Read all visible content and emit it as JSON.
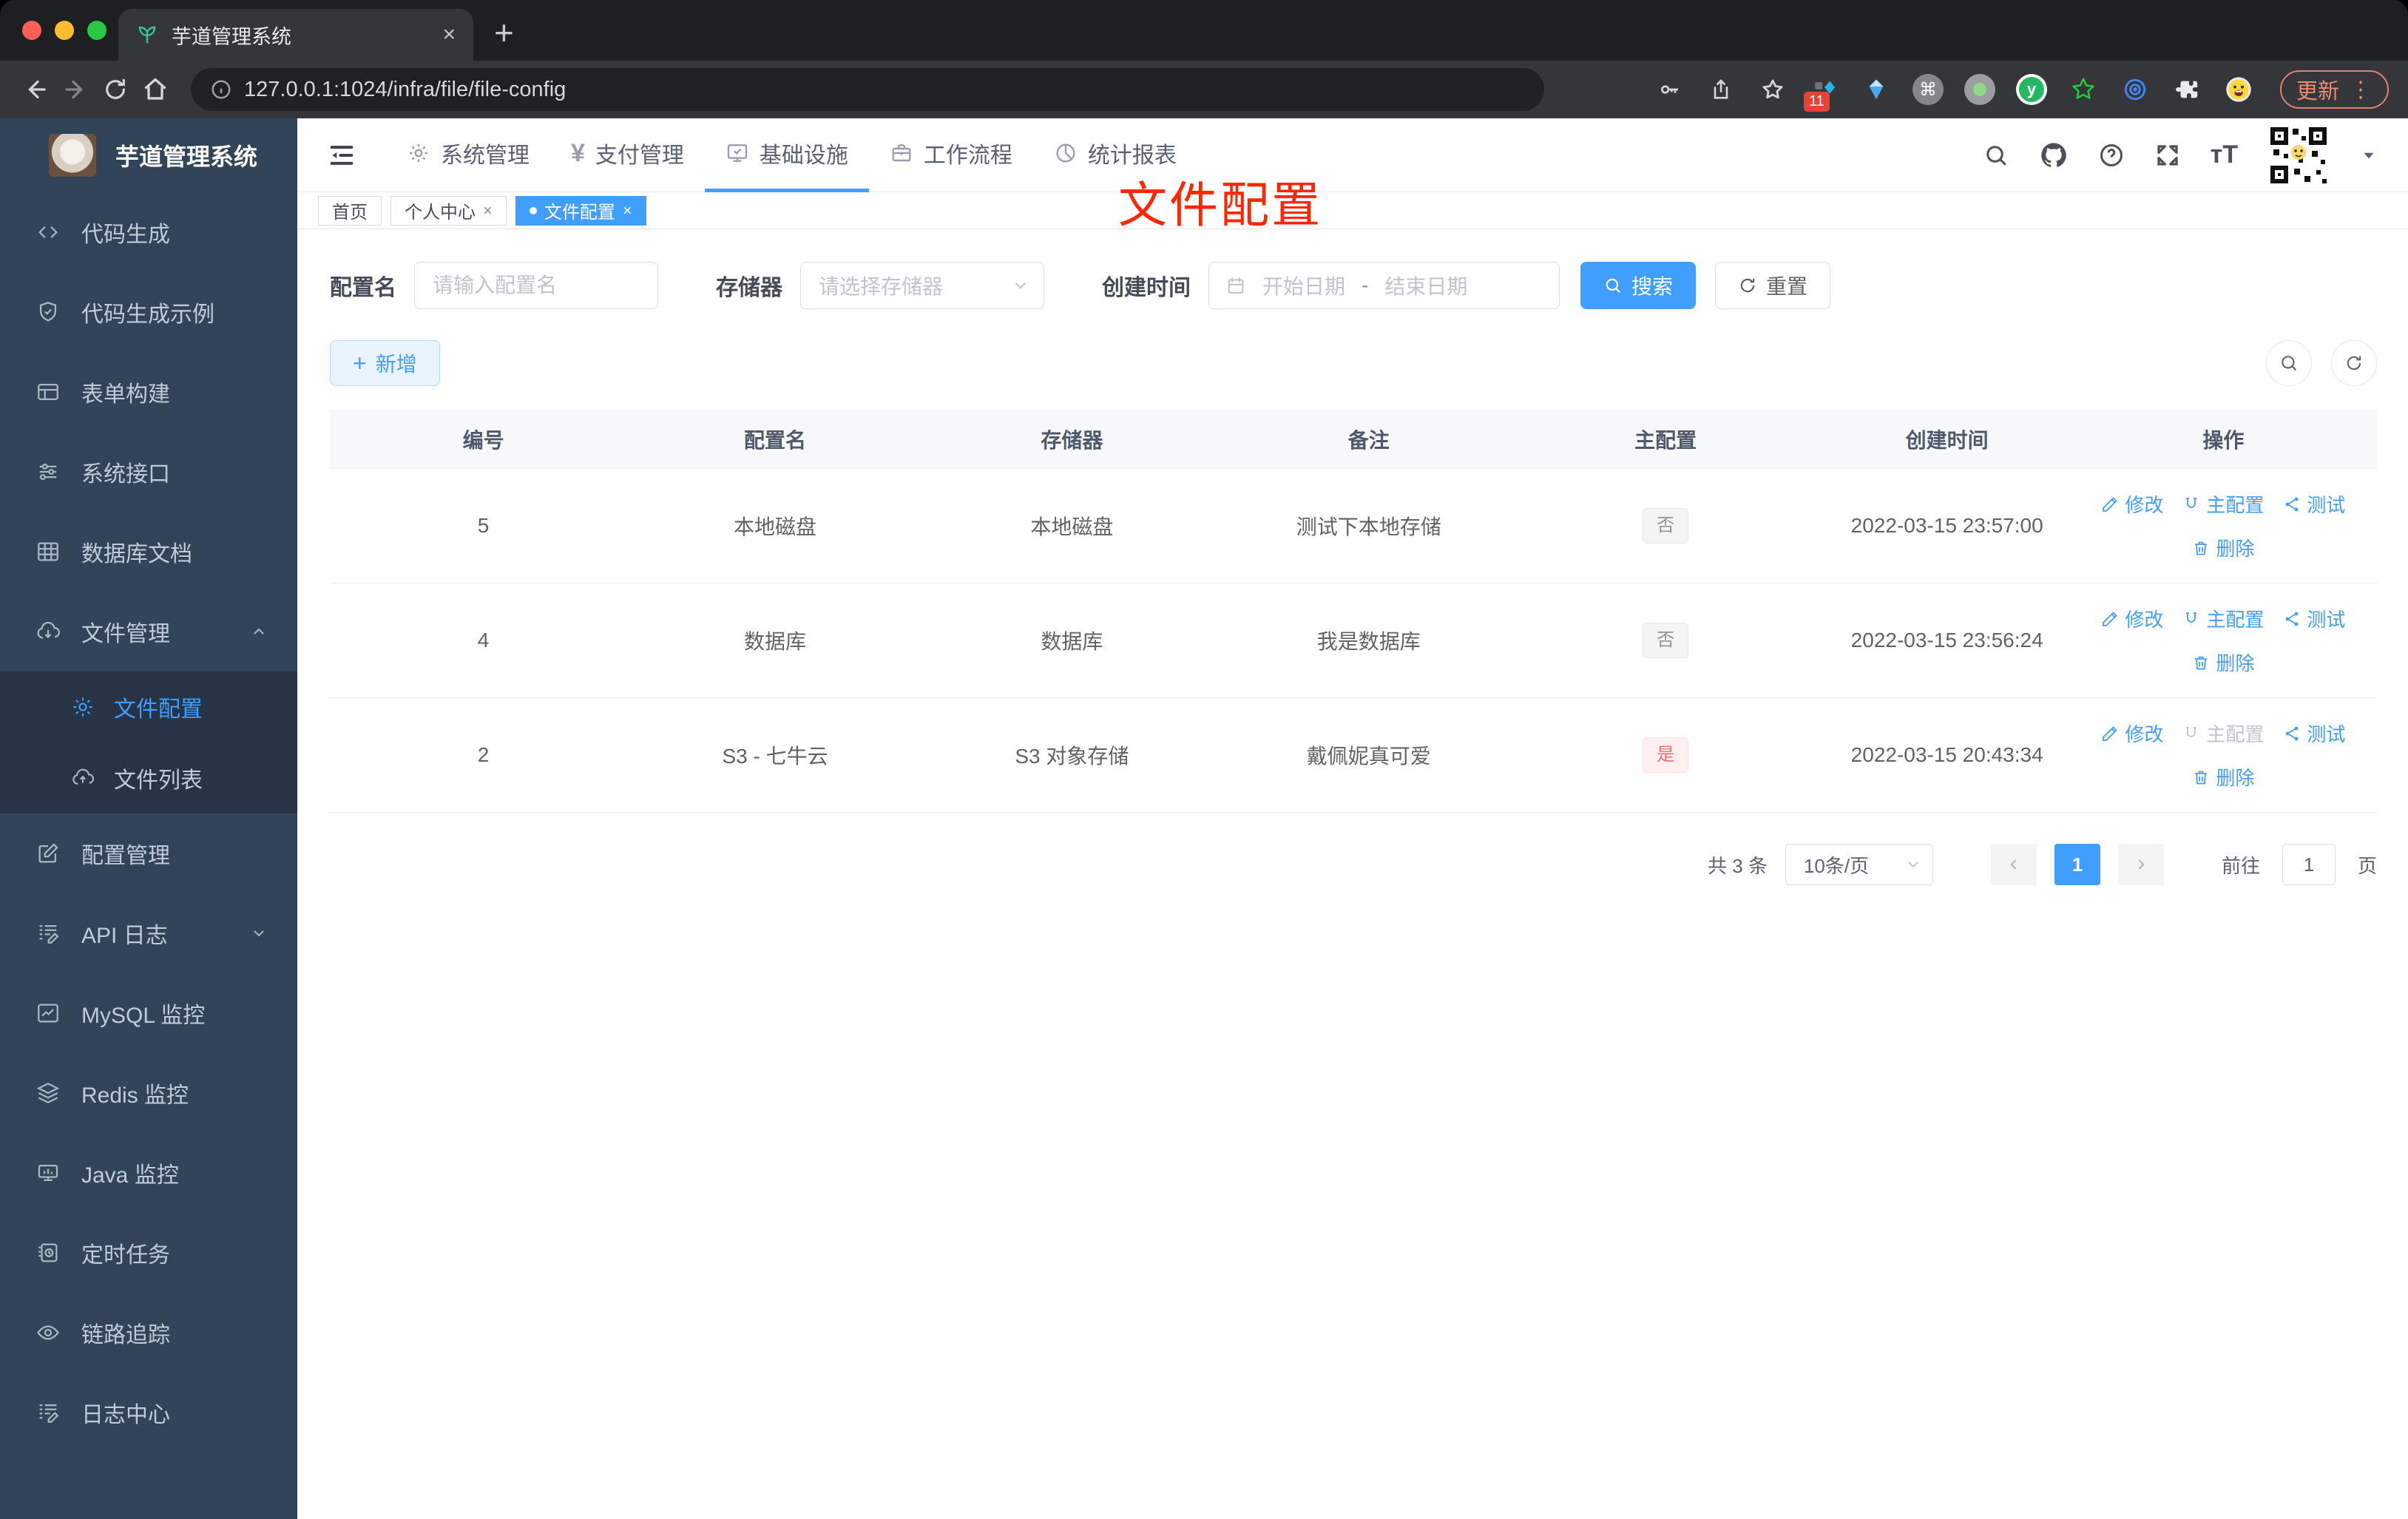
{
  "browser": {
    "tab_title": "芋道管理系统",
    "url": "127.0.0.1:1024/infra/file/file-config",
    "extension_badge": "11",
    "update_label": "更新",
    "toolbar_icons": [
      "back-icon",
      "forward-icon",
      "reload-icon",
      "home-icon",
      "info-icon",
      "key-icon",
      "share-icon",
      "star-icon",
      "extensions",
      "puzzle-icon",
      "emoji-icon",
      "update-chip",
      "menu-dots-icon"
    ]
  },
  "sidebar": {
    "app_title": "芋道管理系统",
    "items": [
      {
        "label": "代码生成",
        "icon": "code-icon"
      },
      {
        "label": "代码生成示例",
        "icon": "shield-check-icon"
      },
      {
        "label": "表单构建",
        "icon": "form-icon"
      },
      {
        "label": "系统接口",
        "icon": "sliders-icon"
      },
      {
        "label": "数据库文档",
        "icon": "table-grid-icon"
      },
      {
        "label": "文件管理",
        "icon": "cloud-download-icon",
        "expanded": true,
        "children": [
          {
            "label": "文件配置",
            "icon": "gear-icon",
            "active": true
          },
          {
            "label": "文件列表",
            "icon": "cloud-upload-icon"
          }
        ]
      },
      {
        "label": "配置管理",
        "icon": "edit-square-icon"
      },
      {
        "label": "API 日志",
        "icon": "log-edit-icon",
        "collapsed": true
      },
      {
        "label": "MySQL 监控",
        "icon": "chart-monitor-icon"
      },
      {
        "label": "Redis 监控",
        "icon": "layers-icon"
      },
      {
        "label": "Java 监控",
        "icon": "java-monitor-icon"
      },
      {
        "label": "定时任务",
        "icon": "schedule-icon"
      },
      {
        "label": "链路追踪",
        "icon": "eye-icon"
      },
      {
        "label": "日志中心",
        "icon": "logfile-icon"
      }
    ]
  },
  "topnav": {
    "items": [
      {
        "label": "系统管理",
        "icon": "gear-icon"
      },
      {
        "label": "支付管理",
        "icon": "yen-icon"
      },
      {
        "label": "基础设施",
        "icon": "monitor-check-icon",
        "active": true
      },
      {
        "label": "工作流程",
        "icon": "briefcase-icon"
      },
      {
        "label": "统计报表",
        "icon": "pie-chart-icon"
      }
    ],
    "tools": [
      "search-icon",
      "github-icon",
      "help-icon",
      "fullscreen-icon",
      "font-size-icon",
      "qr-avatar",
      "caret-down-icon"
    ]
  },
  "tagsview": {
    "tabs": [
      {
        "label": "首页"
      },
      {
        "label": "个人中心",
        "closable": true
      },
      {
        "label": "文件配置",
        "closable": true,
        "active": true
      }
    ]
  },
  "annotation": {
    "title": "文件配置",
    "color": "#ff2600"
  },
  "filters": {
    "name_label": "配置名",
    "name_placeholder": "请输入配置名",
    "storage_label": "存储器",
    "storage_placeholder": "请选择存储器",
    "date_label": "创建时间",
    "date_start_placeholder": "开始日期",
    "date_separator": "-",
    "date_end_placeholder": "结束日期",
    "search_label": "搜索",
    "reset_label": "重置",
    "add_label": "新增"
  },
  "table": {
    "columns": [
      "编号",
      "配置名",
      "存储器",
      "备注",
      "主配置",
      "创建时间",
      "操作"
    ],
    "actions": {
      "edit": "修改",
      "master": "主配置",
      "test": "测试",
      "delete": "删除"
    },
    "rows": [
      {
        "id": "5",
        "name": "本地磁盘",
        "storage": "本地磁盘",
        "remark": "测试下本地存储",
        "master": "否",
        "created": "2022-03-15 23:57:00"
      },
      {
        "id": "4",
        "name": "数据库",
        "storage": "数据库",
        "remark": "我是数据库",
        "master": "否",
        "created": "2022-03-15 23:56:24"
      },
      {
        "id": "2",
        "name": "S3 - 七牛云",
        "storage": "S3 对象存储",
        "remark": "戴佩妮真可爱",
        "master": "是",
        "created": "2022-03-15 20:43:34"
      }
    ]
  },
  "pagination": {
    "total": "共 3 条",
    "page_size": "10条/页",
    "current_page": "1",
    "goto_label": "前往",
    "goto_value": "1",
    "page_unit": "页"
  },
  "colors": {
    "accent": "#409eff",
    "danger": "#f56c6c",
    "sidebar_bg": "#324558",
    "sidebar_sub_bg": "#263445",
    "annotation": "#ff2600"
  }
}
